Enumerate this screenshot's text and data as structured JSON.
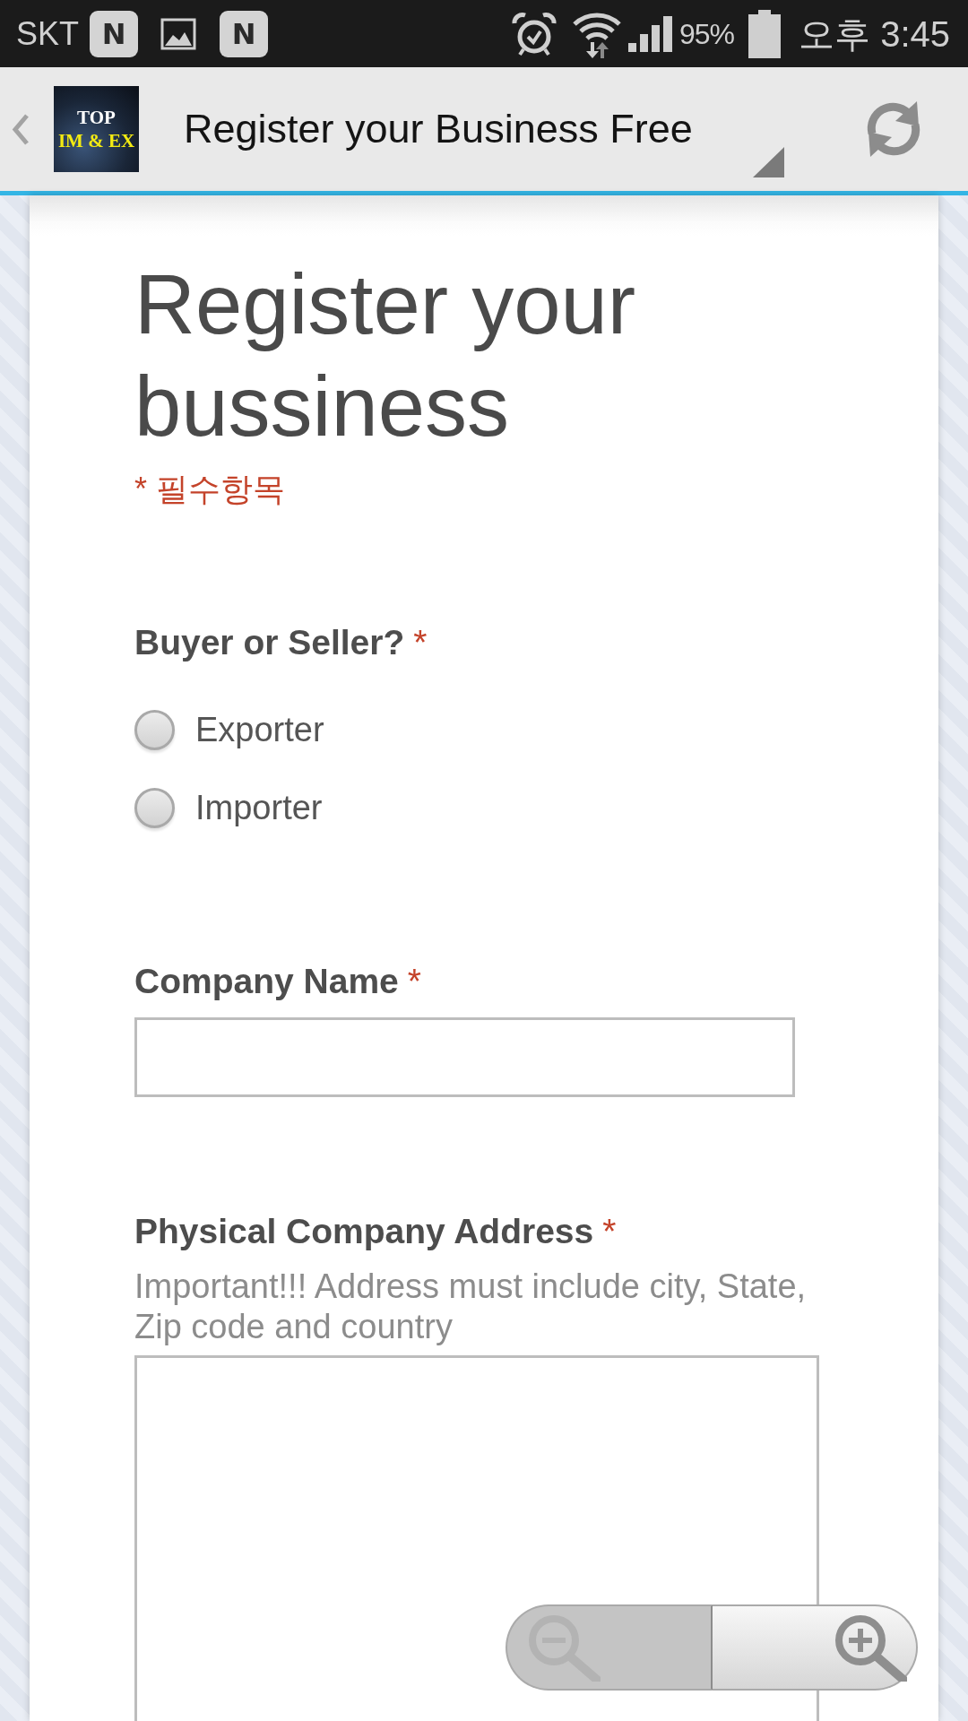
{
  "status_bar": {
    "carrier": "SKT",
    "notifications": [
      {
        "kind": "letter",
        "glyph": "N"
      },
      {
        "kind": "picture"
      },
      {
        "kind": "letter",
        "glyph": "N"
      }
    ],
    "battery": "95%",
    "time": "오후 3:45"
  },
  "app_bar": {
    "logo": [
      "TOP",
      "IM & EX"
    ],
    "title": "Register your Business Free"
  },
  "form": {
    "title": "Register your bussiness",
    "required_note": "* 필수항목",
    "questions": [
      {
        "kind": "radio",
        "label": "Buyer or Seller?",
        "required_mark": "*",
        "options": [
          {
            "label": "Exporter",
            "selected": false
          },
          {
            "label": "Importer",
            "selected": false
          }
        ]
      },
      {
        "kind": "text",
        "label": "Company Name",
        "required_mark": "*"
      },
      {
        "kind": "paragraph",
        "label": "Physical Company Address",
        "required_mark": "*",
        "help": "Important!!! Address must include city, State, Zip code and country"
      }
    ]
  },
  "zoom_controls": [
    {
      "kind": "zoom_out",
      "disabled": true
    },
    {
      "kind": "zoom_in",
      "disabled": false
    }
  ]
}
